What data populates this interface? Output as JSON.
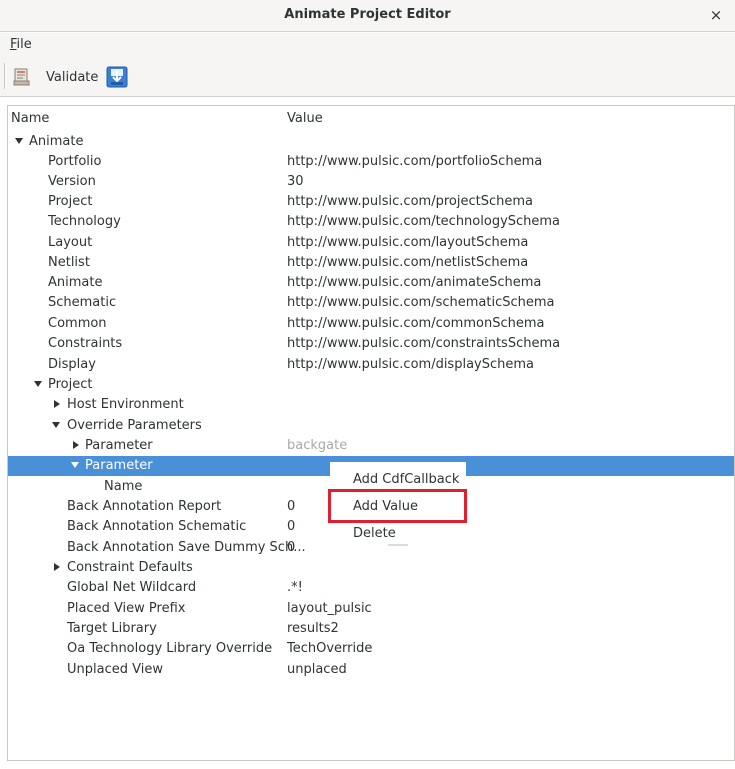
{
  "window": {
    "title": "Animate Project Editor",
    "close_glyph": "×"
  },
  "menubar": {
    "file_accel": "F",
    "file_rest": "ile"
  },
  "toolbar": {
    "validate_label": "Validate",
    "validate_icon": "document-check-icon",
    "save_icon": "save-download-icon"
  },
  "tree": {
    "columns": {
      "name": "Name",
      "value": "Value"
    },
    "rows": [
      {
        "label": "Animate",
        "value": "",
        "expander": "down"
      },
      {
        "label": "Portfolio",
        "value": "http://www.pulsic.com/portfolioSchema",
        "expander": ""
      },
      {
        "label": "Version",
        "value": "30",
        "expander": ""
      },
      {
        "label": "Project",
        "value": "http://www.pulsic.com/projectSchema",
        "expander": ""
      },
      {
        "label": "Technology",
        "value": "http://www.pulsic.com/technologySchema",
        "expander": ""
      },
      {
        "label": "Layout",
        "value": "http://www.pulsic.com/layoutSchema",
        "expander": ""
      },
      {
        "label": "Netlist",
        "value": "http://www.pulsic.com/netlistSchema",
        "expander": ""
      },
      {
        "label": "Animate",
        "value": "http://www.pulsic.com/animateSchema",
        "expander": ""
      },
      {
        "label": "Schematic",
        "value": "http://www.pulsic.com/schematicSchema",
        "expander": ""
      },
      {
        "label": "Common",
        "value": "http://www.pulsic.com/commonSchema",
        "expander": ""
      },
      {
        "label": "Constraints",
        "value": "http://www.pulsic.com/constraintsSchema",
        "expander": ""
      },
      {
        "label": "Display",
        "value": "http://www.pulsic.com/displaySchema",
        "expander": ""
      },
      {
        "label": "Project",
        "value": "",
        "expander": "down"
      },
      {
        "label": "Host Environment",
        "value": "",
        "expander": "right"
      },
      {
        "label": "Override Parameters",
        "value": "",
        "expander": "down"
      },
      {
        "label": "Parameter",
        "value": "backgate",
        "expander": "right"
      },
      {
        "label": "Parameter",
        "value": "",
        "expander": "down"
      },
      {
        "label": "Name",
        "value": "",
        "expander": ""
      },
      {
        "label": "Back Annotation Report",
        "value": "0",
        "expander": ""
      },
      {
        "label": "Back Annotation Schematic",
        "value": "0",
        "expander": ""
      },
      {
        "label": "Back Annotation Save Dummy Sch...",
        "value": "0",
        "expander": ""
      },
      {
        "label": "Constraint Defaults",
        "value": "",
        "expander": "right"
      },
      {
        "label": "Global Net Wildcard",
        "value": ".*!",
        "expander": ""
      },
      {
        "label": "Placed View Prefix",
        "value": "layout_pulsic",
        "expander": ""
      },
      {
        "label": "Target Library",
        "value": "results2",
        "expander": ""
      },
      {
        "label": "Oa Technology Library Override",
        "value": "TechOverride",
        "expander": ""
      },
      {
        "label": "Unplaced View",
        "value": "unplaced",
        "expander": ""
      }
    ]
  },
  "context_menu": {
    "items": [
      "Add CdfCallback",
      "Add Value",
      "Delete"
    ],
    "highlighted": "Add Value"
  },
  "colors": {
    "selection": "#4a90d9",
    "highlight_box": "#e0202c"
  }
}
